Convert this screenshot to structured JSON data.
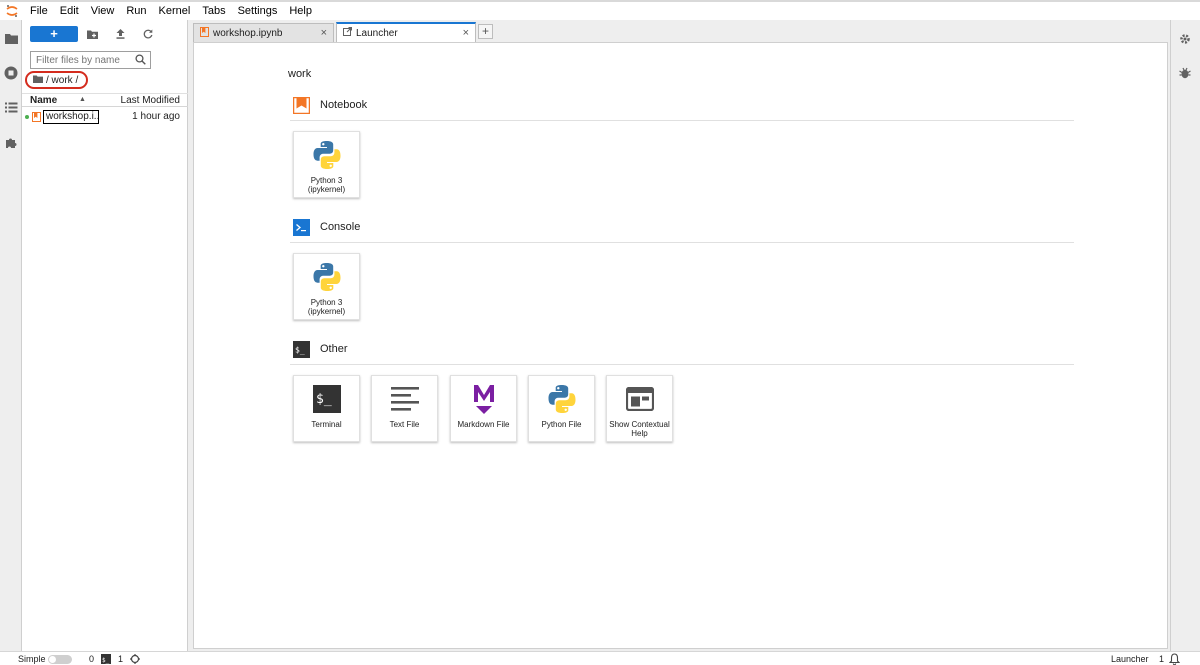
{
  "menu": [
    "File",
    "Edit",
    "View",
    "Run",
    "Kernel",
    "Tabs",
    "Settings",
    "Help"
  ],
  "filebrowser": {
    "new_label": "+",
    "filter_placeholder": "Filter files by name",
    "breadcrumb": "/ work /",
    "col_name": "Name",
    "col_modified": "Last Modified",
    "files": [
      {
        "name": "workshop.i...",
        "modified": "1 hour ago"
      }
    ]
  },
  "tabs": [
    {
      "label": "workshop.ipynb",
      "close": "×"
    },
    {
      "label": "Launcher",
      "close": "×"
    }
  ],
  "tab_add": "+",
  "launcher": {
    "cwd": "work",
    "sections": {
      "notebook": {
        "title": "Notebook",
        "cards": [
          {
            "label": "Python 3 (ipykernel)"
          }
        ]
      },
      "console": {
        "title": "Console",
        "cards": [
          {
            "label": "Python 3 (ipykernel)"
          }
        ]
      },
      "other": {
        "title": "Other",
        "cards": [
          {
            "label": "Terminal"
          },
          {
            "label": "Text File"
          },
          {
            "label": "Markdown File"
          },
          {
            "label": "Python File"
          },
          {
            "label": "Show Contextual Help"
          }
        ]
      }
    }
  },
  "status": {
    "mode_label": "Simple",
    "kernels_count": "0",
    "terminals_count": "1",
    "right_label": "Launcher",
    "right_count": "1"
  },
  "colors": {
    "accent": "#1976d2",
    "notebook_orange": "#f37626",
    "markdown_purple": "#7b1fa2",
    "highlight_red": "#d42c1e",
    "kernel_dot": "#4caf50"
  },
  "icons": [
    "jupyter-logo-icon",
    "folder-icon",
    "running-icon",
    "toc-icon",
    "extension-icon",
    "new-folder-icon",
    "upload-icon",
    "refresh-icon",
    "search-icon",
    "notebook-icon",
    "console-icon",
    "terminal-icon",
    "text-file-icon",
    "markdown-icon",
    "python-icon",
    "help-icon",
    "property-inspector-icon",
    "debugger-icon",
    "bell-icon"
  ]
}
